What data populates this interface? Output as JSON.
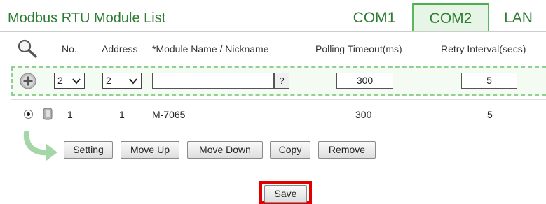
{
  "header": {
    "title": "Modbus RTU Module List",
    "tabs": [
      {
        "label": "COM1",
        "active": false
      },
      {
        "label": "COM2",
        "active": true
      },
      {
        "label": "LAN",
        "active": false
      }
    ]
  },
  "columns": {
    "no": "No.",
    "address": "Address",
    "module_name": "*Module Name / Nickname",
    "polling_timeout": "Polling Timeout(ms)",
    "retry_interval": "Retry Interval(secs)"
  },
  "add_row": {
    "no_value": "2",
    "address_value": "2",
    "module_name_value": "",
    "help_label": "?",
    "polling_timeout_value": "300",
    "retry_interval_value": "5"
  },
  "modules": [
    {
      "no": "1",
      "address": "1",
      "name": "M-7065",
      "polling_timeout": "300",
      "retry_interval": "5",
      "selected": true
    }
  ],
  "actions": {
    "setting": "Setting",
    "move_up": "Move Up",
    "move_down": "Move Down",
    "copy": "Copy",
    "remove": "Remove"
  },
  "save_label": "Save",
  "colors": {
    "accent_green": "#2e7d32",
    "active_tab_bg": "#e7f5e6",
    "highlight_red": "#e00000"
  },
  "icons": [
    "search-icon",
    "add-icon",
    "chevron-down-icon",
    "module-icon",
    "curved-arrow-icon"
  ]
}
